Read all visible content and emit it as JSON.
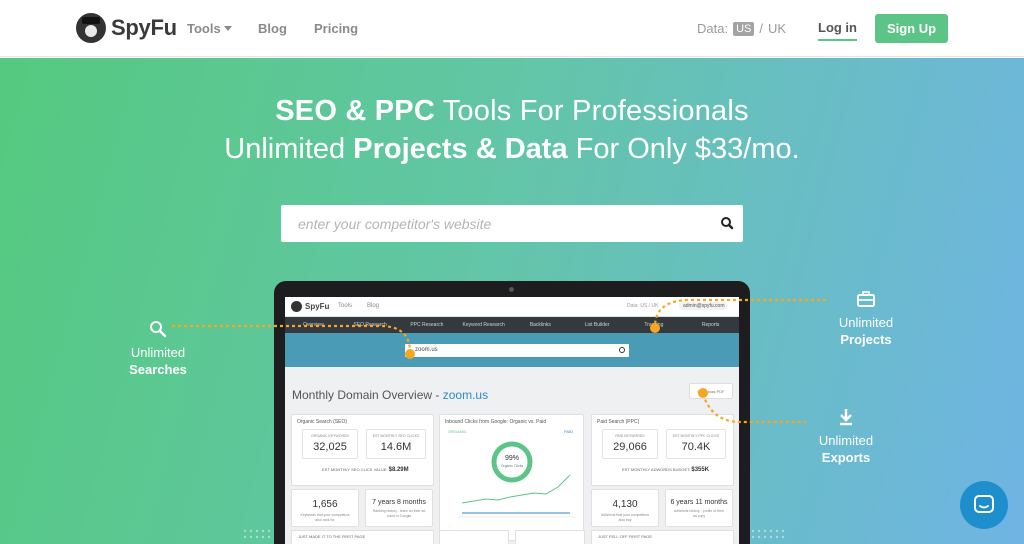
{
  "header": {
    "logo_text": "SpyFu",
    "nav": {
      "tools": "Tools",
      "blog": "Blog",
      "pricing": "Pricing"
    },
    "data_label": "Data:",
    "data_us": "US",
    "data_separator": "/",
    "data_uk": "UK",
    "login": "Log in",
    "signup": "Sign Up"
  },
  "hero": {
    "line1_bold": "SEO & PPC",
    "line1_rest": " Tools For Professionals",
    "line2_a": "Unlimited ",
    "line2_bold": "Projects & Data",
    "line2_rest": " For Only $33/mo.",
    "search_placeholder": "enter your competitor's website",
    "features": {
      "searches": {
        "label": "Unlimited",
        "strong": "Searches"
      },
      "projects": {
        "label": "Unlimited",
        "strong": "Projects"
      },
      "exports": {
        "label": "Unlimited",
        "strong": "Exports"
      }
    }
  },
  "mockup": {
    "logo_text": "SpyFu",
    "nav_tools": "Tools",
    "nav_blog": "Blog",
    "data": "Data: US / UK",
    "user": "admin@spyfu.com",
    "tabs": [
      "Overview",
      "SEO Research",
      "PPC Research",
      "Keyword Research",
      "Backlinks",
      "List Builder",
      "Tracking",
      "Reports"
    ],
    "search_value": "zoom.us",
    "title": "Monthly Domain Overview - ",
    "title_domain": "zoom.us",
    "pdf_button": "Download PDF",
    "organic_card": {
      "title": "Organic Search (SEO)",
      "kpi1_cap": "ORGANIC KEYWORDS",
      "kpi1_val": "32,025",
      "kpi2_cap": "EST MONTHLY SEO CLICKS",
      "kpi2_val": "14.6M",
      "foot_label": "EST MONTHLY SEO CLICK VALUE:",
      "foot_val": "$8.29M"
    },
    "inbound_card": {
      "title": "Inbound Clicks from Google: Organic vs. Paid",
      "legend_organic": "ORGANIC",
      "legend_paid": "PAID",
      "donut_pct": "99%",
      "donut_label": "Organic Clicks"
    },
    "paid_card": {
      "title": "Paid Search (PPC)",
      "kpi1_cap": "PAID KEYWORDS",
      "kpi1_val": "29,066",
      "kpi2_cap": "EST MONTHLY PPC CLICKS",
      "kpi2_val": "70.4K",
      "foot_label": "EST MONTHLY ADWORDS BUDGET:",
      "foot_val": "$355K"
    },
    "mini": [
      {
        "num": "1,656",
        "cap": "Keywords that your competitors also rank for"
      },
      {
        "num": "7 years 8 months",
        "cap": "Ranking history - learn on their ad count in Google"
      },
      {
        "num": "4,130",
        "cap": "AdWords that your competitors also buy"
      },
      {
        "num": "6 years 11 months",
        "cap": "AdWords history - profile of their ad copy"
      }
    ],
    "bottom": [
      "JUST MADE IT TO THE FIRST PAGE",
      "JUST FELL OFF FIRST PAGE"
    ]
  },
  "colors": {
    "brand_green": "#5cc486",
    "accent_orange": "#f5a623",
    "chat_blue": "#1f8ecd"
  },
  "icons": {
    "search": "search-icon",
    "projects": "briefcase-icon",
    "exports": "download-icon",
    "chat": "chat-icon"
  }
}
